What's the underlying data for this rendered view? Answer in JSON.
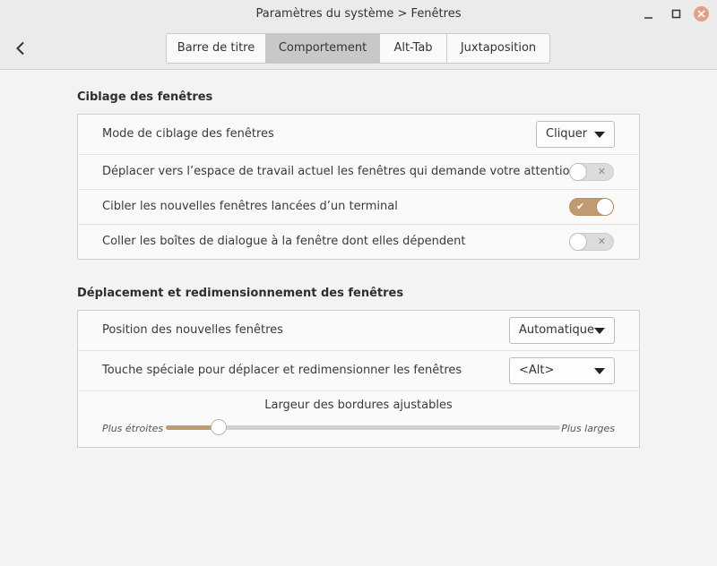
{
  "window": {
    "title": "Paramètres du système > Fenêtres",
    "controls": {
      "minimize": "–",
      "maximize": "□",
      "close": "×"
    }
  },
  "tabs": [
    {
      "label": "Barre de titre",
      "active": false
    },
    {
      "label": "Comportement",
      "active": true
    },
    {
      "label": "Alt-Tab",
      "active": false
    },
    {
      "label": "Juxtaposition",
      "active": false
    }
  ],
  "focus_section": {
    "title": "Ciblage des fenêtres",
    "rows": [
      {
        "label": "Mode de ciblage des fenêtres",
        "type": "dropdown",
        "value": "Cliquer"
      },
      {
        "label": "Déplacer vers l’espace de travail actuel les fenêtres qui demande votre attention",
        "type": "switch",
        "on": false
      },
      {
        "label": "Cibler les nouvelles fenêtres lancées d’un terminal",
        "type": "switch",
        "on": true
      },
      {
        "label": "Coller les boîtes de dialogue à la fenêtre dont elles dépendent",
        "type": "switch",
        "on": false
      }
    ]
  },
  "move_section": {
    "title": "Déplacement et redimensionnement des fenêtres",
    "rows": [
      {
        "label": "Position des nouvelles fenêtres",
        "type": "dropdown",
        "value": "Automatique"
      },
      {
        "label": "Touche spéciale pour déplacer et redimensionner les fenêtres",
        "type": "dropdown",
        "value": "<Alt>"
      }
    ],
    "slider": {
      "title": "Largeur des bordures ajustables",
      "min_label": "Plus étroites",
      "max_label": "Plus larges",
      "value_fraction": 0.135
    }
  },
  "colors": {
    "accent": "#c19a72",
    "close_button": "#e2a183"
  },
  "icons": {
    "back": "chevron-left-icon",
    "switch_on": "checkmark-icon",
    "switch_off": "x-mark-icon"
  }
}
